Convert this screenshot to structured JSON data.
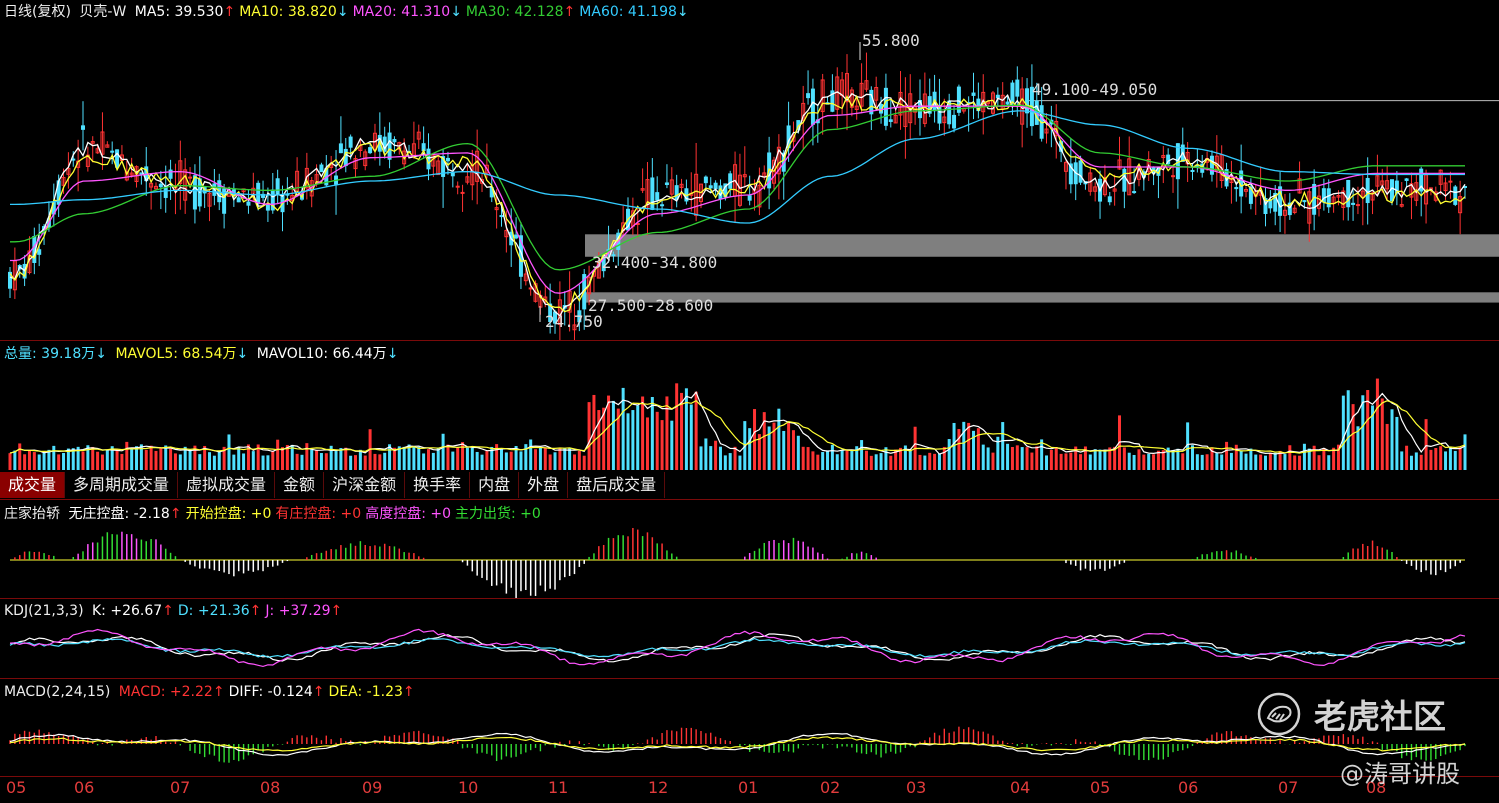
{
  "colors": {
    "up": "#ff3333",
    "down": "#4fe0ff",
    "ma5": "#ffffff",
    "ma10": "#ffff33",
    "ma20": "#ff55ff",
    "ma30": "#33cc33",
    "ma60": "#33ccff",
    "grid": "#7a0a0a",
    "zone": "#7f7f7f"
  },
  "header": {
    "title": "日线(复权)",
    "stock": "贝壳-W",
    "ma": [
      {
        "label": "MA5: 39.530",
        "arrow": "↑",
        "color": "#ffffff"
      },
      {
        "label": "MA10: 38.820",
        "arrow": "↓",
        "color": "#ffff33"
      },
      {
        "label": "MA20: 41.310",
        "arrow": "↓",
        "color": "#ff55ff"
      },
      {
        "label": "MA30: 42.128",
        "arrow": "↑",
        "color": "#33cc33"
      },
      {
        "label": "MA60: 41.198",
        "arrow": "↓",
        "color": "#33ccff"
      }
    ]
  },
  "annotations": {
    "high": "55.800",
    "low": "24.750",
    "resistance": "49.100-49.050",
    "zone_upper": "32.400-34.800",
    "zone_lower": "27.500-28.600"
  },
  "volume": {
    "total": "总量: 39.18万",
    "total_arrow": "↓",
    "mavol5": "MAVOL5: 68.54万",
    "mavol5_arrow": "↓",
    "mavol10": "MAVOL10: 66.44万",
    "mavol10_arrow": "↓"
  },
  "tabs": [
    "成交量",
    "多周期成交量",
    "虚拟成交量",
    "金额",
    "沪深金额",
    "换手率",
    "内盘",
    "外盘",
    "盘后成交量"
  ],
  "zhuangjia": {
    "name": "庄家抬轿",
    "items": [
      {
        "label": "无庄控盘: -2.18",
        "arrow": "↑",
        "color": "#ffffff"
      },
      {
        "label": "开始控盘: +0",
        "arrow": "",
        "color": "#ffff33"
      },
      {
        "label": "有庄控盘: +0",
        "arrow": "",
        "color": "#ff3333"
      },
      {
        "label": "高度控盘: +0",
        "arrow": "",
        "color": "#ff55ff"
      },
      {
        "label": "主力出货: +0",
        "arrow": "",
        "color": "#33dd33"
      }
    ]
  },
  "kdj": {
    "name": "KDJ(21,3,3)",
    "items": [
      {
        "label": "K: +26.67",
        "arrow": "↑",
        "color": "#ffffff"
      },
      {
        "label": "D: +21.36",
        "arrow": "↑",
        "color": "#4fe0ff"
      },
      {
        "label": "J: +37.29",
        "arrow": "↑",
        "color": "#ff55ff"
      }
    ]
  },
  "macd": {
    "name": "MACD(2,24,15)",
    "items": [
      {
        "label": "MACD: +2.22",
        "arrow": "↑",
        "color": "#ff3333"
      },
      {
        "label": "DIFF: -0.124",
        "arrow": "↑",
        "color": "#ffffff"
      },
      {
        "label": "DEA: -1.23",
        "arrow": "↑",
        "color": "#ffff33"
      }
    ]
  },
  "x_axis": [
    "05",
    "06",
    "07",
    "08",
    "09",
    "10",
    "11",
    "12",
    "01",
    "02",
    "03",
    "04",
    "05",
    "06",
    "07",
    "08"
  ],
  "watermark": {
    "brand": "老虎社区",
    "author": "@涛哥讲股"
  },
  "chart_data": {
    "type": "line",
    "title": "日线(复权) 贝壳-W",
    "xlabel": "",
    "ylabel": "",
    "x": [
      "05",
      "06",
      "07",
      "08",
      "09",
      "10",
      "11",
      "12",
      "01",
      "02",
      "03",
      "04",
      "05",
      "06",
      "07",
      "08"
    ],
    "series": [
      {
        "name": "MA5",
        "values": [
          30.5,
          44.0,
          40.0,
          38.5,
          44.5,
          42.0,
          26.5,
          39.0,
          40.0,
          49.5,
          48.5,
          49.0,
          40.0,
          43.0,
          38.0,
          39.53
        ]
      },
      {
        "name": "MA10",
        "values": [
          30.5,
          43.0,
          40.5,
          38.0,
          44.0,
          42.5,
          27.0,
          38.5,
          39.5,
          49.0,
          48.5,
          48.8,
          41.0,
          42.5,
          38.5,
          38.82
        ]
      },
      {
        "name": "MA20",
        "values": [
          32.0,
          40.5,
          41.5,
          38.0,
          43.0,
          43.5,
          28.5,
          37.0,
          39.0,
          47.5,
          48.5,
          48.5,
          42.0,
          42.0,
          39.5,
          41.31
        ]
      },
      {
        "name": "MA30",
        "values": [
          34.0,
          37.0,
          40.0,
          39.5,
          41.0,
          44.5,
          31.0,
          35.0,
          37.5,
          46.0,
          48.0,
          48.6,
          43.5,
          42.0,
          40.5,
          42.128
        ]
      },
      {
        "name": "MA60",
        "values": [
          38.0,
          38.5,
          39.5,
          39.0,
          40.5,
          41.5,
          39.0,
          37.5,
          36.0,
          41.0,
          45.0,
          48.0,
          46.5,
          44.0,
          41.5,
          41.198
        ]
      }
    ],
    "ylim": [
      23.5,
      57.5
    ],
    "key_levels": {
      "high": 55.8,
      "low": 24.75,
      "resistance": [
        49.1,
        49.05
      ],
      "zone_upper": [
        32.4,
        34.8
      ],
      "zone_lower": [
        27.5,
        28.6
      ]
    },
    "grid": false,
    "legend": "top-left"
  }
}
